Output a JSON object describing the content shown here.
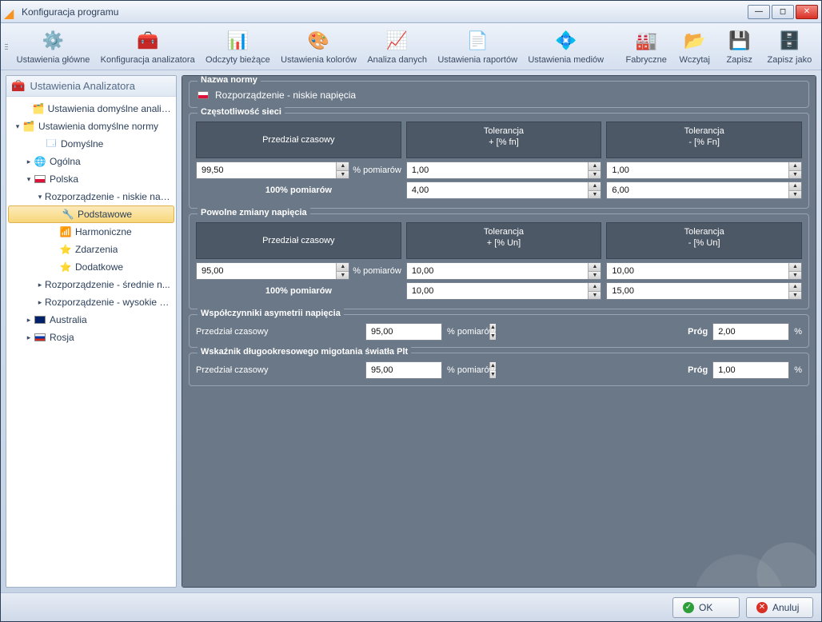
{
  "window": {
    "title": "Konfiguracja programu"
  },
  "toolbar": {
    "items": [
      {
        "label": "Ustawienia główne",
        "icon": "⚙️"
      },
      {
        "label": "Konfiguracja analizatora",
        "icon": "🧰"
      },
      {
        "label": "Odczyty bieżące",
        "icon": "📊"
      },
      {
        "label": "Ustawienia kolorów",
        "icon": "🎨"
      },
      {
        "label": "Analiza danych",
        "icon": "📈"
      },
      {
        "label": "Ustawienia raportów",
        "icon": "📄"
      },
      {
        "label": "Ustawienia mediów",
        "icon": "💠"
      }
    ],
    "right": [
      {
        "label": "Fabryczne",
        "icon": "🏭"
      },
      {
        "label": "Wczytaj",
        "icon": "📂"
      },
      {
        "label": "Zapisz",
        "icon": "💾"
      },
      {
        "label": "Zapisz jako",
        "icon": "🗄️"
      }
    ]
  },
  "sidebar": {
    "title": "Ustawienia Analizatora",
    "root1": "Ustawienia domyślne analizatora",
    "root2": "Ustawienia domyślne normy",
    "n_domyslne": "Domyślne",
    "n_ogolna": "Ogólna",
    "n_polska": "Polska",
    "n_rozp_niskie": "Rozporządzenie - niskie nap...",
    "n_podstawowe": "Podstawowe",
    "n_harmoniczne": "Harmoniczne",
    "n_zdarzenia": "Zdarzenia",
    "n_dodatkowe": "Dodatkowe",
    "n_rozp_srednie": "Rozporządzenie - średnie n...",
    "n_rozp_wysokie": "Rozporządzenie - wysokie n...",
    "n_australia": "Australia",
    "n_rosja": "Rosja"
  },
  "panel": {
    "nazwa_legend": "Nazwa normy",
    "nazwa_value": "Rozporządzenie - niskie napięcia",
    "czest_legend": "Częstotliwość sieci",
    "col_przedzial": "Przedział czasowy",
    "col_tol_plus_fn": "Tolerancja\n+ [% fn]",
    "col_tol_minus_fn": "Tolerancja\n- [% Fn]",
    "unit_pomiarow": "% pomiarów",
    "row_100_label": "100% pomiarów",
    "czest_val1": "99,50",
    "czest_tolp1": "1,00",
    "czest_tolm1": "1,00",
    "czest_tolp2": "4,00",
    "czest_tolm2": "6,00",
    "pow_legend": "Powolne zmiany napięcia",
    "col_tol_plus_un": "Tolerancja\n+ [% Un]",
    "col_tol_minus_un": "Tolerancja\n- [% Un]",
    "pow_val1": "95,00",
    "pow_tolp1": "10,00",
    "pow_tolm1": "10,00",
    "pow_tolp2": "10,00",
    "pow_tolm2": "15,00",
    "asym_legend": "Współczynniki asymetrii napięcia",
    "lbl_przedzial": "Przedział czasowy",
    "asym_val": "95,00",
    "lbl_prog": "Próg",
    "asym_prog": "2,00",
    "unit_percent": "%",
    "plt_legend": "Wskaźnik długookresowego migotania światła Plt",
    "plt_val": "95,00",
    "plt_prog": "1,00"
  },
  "footer": {
    "ok": "OK",
    "cancel": "Anuluj"
  }
}
